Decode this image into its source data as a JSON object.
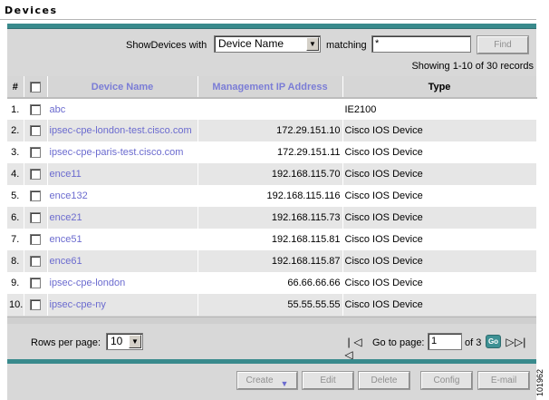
{
  "header": {
    "title": "Devices"
  },
  "filter": {
    "show_label": "ShowDevices with",
    "field_selected": "Device Name",
    "matching_label": "matching",
    "match_value": "*",
    "find_label": "Find"
  },
  "summary": {
    "showing": "Showing 1-10 of 30 records"
  },
  "table": {
    "headers": {
      "index": "#",
      "name": "Device Name",
      "ip": "Management IP Address",
      "type": "Type"
    },
    "rows": [
      {
        "idx": "1.",
        "name": "abc",
        "ip": "",
        "type": "IE2100"
      },
      {
        "idx": "2.",
        "name": "ipsec-cpe-london-test.cisco.com",
        "ip": "172.29.151.10",
        "type": "Cisco IOS Device"
      },
      {
        "idx": "3.",
        "name": "ipsec-cpe-paris-test.cisco.com",
        "ip": "172.29.151.11",
        "type": "Cisco IOS Device"
      },
      {
        "idx": "4.",
        "name": "ence11",
        "ip": "192.168.115.70",
        "type": "Cisco IOS Device"
      },
      {
        "idx": "5.",
        "name": "ence132",
        "ip": "192.168.115.116",
        "type": "Cisco IOS Device"
      },
      {
        "idx": "6.",
        "name": "ence21",
        "ip": "192.168.115.73",
        "type": "Cisco IOS Device"
      },
      {
        "idx": "7.",
        "name": "ence51",
        "ip": "192.168.115.81",
        "type": "Cisco IOS Device"
      },
      {
        "idx": "8.",
        "name": "ence61",
        "ip": "192.168.115.87",
        "type": "Cisco IOS Device"
      },
      {
        "idx": "9.",
        "name": "ipsec-cpe-london",
        "ip": "66.66.66.66",
        "type": "Cisco IOS Device"
      },
      {
        "idx": "10.",
        "name": "ipsec-cpe-ny",
        "ip": "55.55.55.55",
        "type": "Cisco IOS Device"
      }
    ]
  },
  "pager": {
    "rows_label": "Rows per page:",
    "rows_value": "10",
    "goto_label": "Go to page:",
    "page_value": "1",
    "of_label": "of 3",
    "go_label": "Go"
  },
  "actions": {
    "create": "Create",
    "edit": "Edit",
    "delete": "Delete",
    "config": "Config",
    "email": "E-mail"
  },
  "figure_number": "101962",
  "colors": {
    "accent": "#398a8c",
    "link": "#6b6bcf",
    "header_link": "#7b7dd6"
  }
}
